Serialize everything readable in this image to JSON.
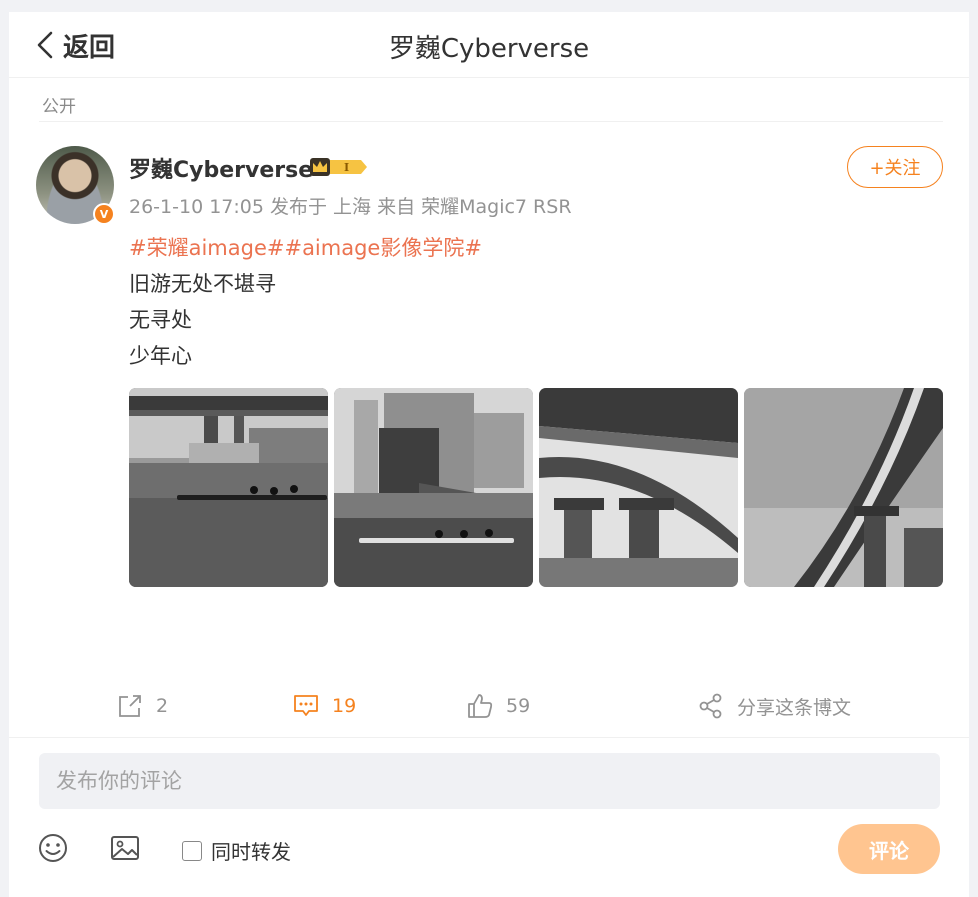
{
  "header": {
    "back_label": "返回",
    "title": "罗巍Cyberverse"
  },
  "post": {
    "visibility": "公开",
    "author": {
      "name": "罗巍Cyberverse",
      "verified_mark": "V"
    },
    "meta": "26-1-10 17:05 发布于 上海 来自 荣耀Magic7 RSR",
    "follow_label": "+关注",
    "tags": "#荣耀aimage##aimage影像学院#",
    "lines": [
      "旧游无处不堪寻",
      "无寻处",
      "少年心"
    ],
    "photos": [
      "photo-1",
      "photo-2",
      "photo-3",
      "photo-4"
    ]
  },
  "actions": {
    "repost": {
      "icon": "repost-icon",
      "count": "2"
    },
    "comment": {
      "icon": "comment-icon",
      "count": "19",
      "color": "#f5821f"
    },
    "like": {
      "icon": "thumbs-up-icon",
      "count": "59"
    },
    "share": {
      "icon": "share-icon",
      "label": "分享这条博文"
    }
  },
  "comment_box": {
    "placeholder": "发布你的评论",
    "sync_repost_label": "同时转发",
    "submit_label": "评论"
  },
  "colors": {
    "accent": "#f5821f",
    "tag": "#eb7350",
    "submit_disabled": "#ffc590"
  }
}
